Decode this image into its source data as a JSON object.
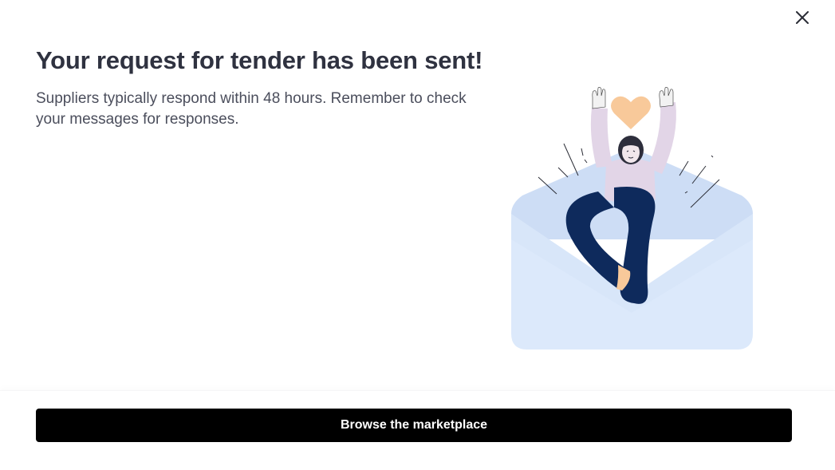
{
  "dialog": {
    "title": "Your request for tender has been sent!",
    "subtitle": "Suppliers typically respond within 48 hours. Remember to check your messages for responses.",
    "close_icon": "close-icon",
    "illustration_icon": "woman-celebrating-envelope-illustration"
  },
  "footer": {
    "primary_button_label": "Browse the marketplace"
  },
  "colors": {
    "title": "#2f3240",
    "button_bg": "#000000",
    "button_text": "#ffffff",
    "envelope": "#dce9fb",
    "envelope_flap": "#cdddf5",
    "heart": "#f8c99a",
    "sweater": "#e2d5e7",
    "pants": "#0e2a5c"
  }
}
